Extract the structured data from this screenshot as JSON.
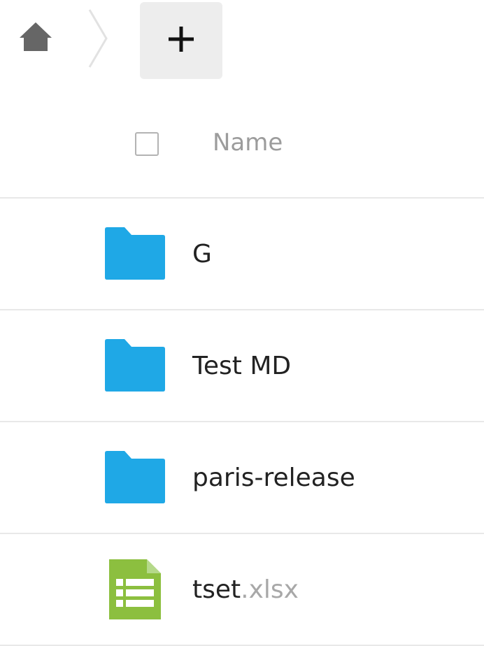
{
  "toolbar": {
    "home_icon": "home-icon",
    "separator_icon": "chevron-right-icon",
    "new_button_label": "+"
  },
  "list_header": {
    "select_all_icon": "checkbox-icon",
    "name_label": "Name"
  },
  "files": [
    {
      "name": "G",
      "extension": "",
      "type": "folder",
      "icon": "folder-icon"
    },
    {
      "name": "Test MD",
      "extension": "",
      "type": "folder",
      "icon": "folder-icon"
    },
    {
      "name": "paris-release",
      "extension": "",
      "type": "folder",
      "icon": "folder-icon"
    },
    {
      "name": "tset",
      "extension": ".xlsx",
      "type": "spreadsheet",
      "icon": "spreadsheet-icon"
    }
  ],
  "colors": {
    "folder": "#1fa8e6",
    "spreadsheet": "#8cbf3f",
    "header_text": "#9c9c9c",
    "extension_text": "#a8a8a8",
    "new_button_bg": "#ededed"
  }
}
